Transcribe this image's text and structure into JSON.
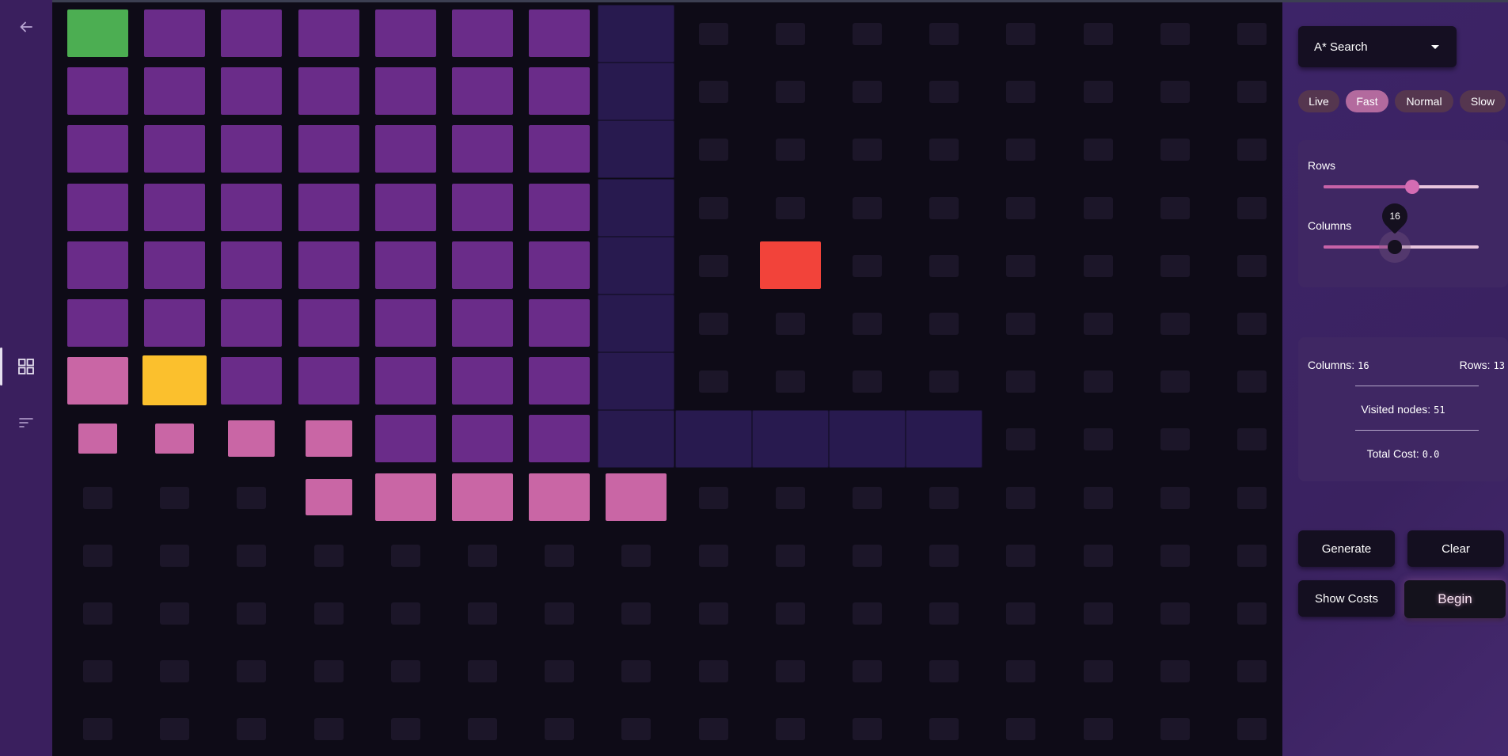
{
  "colors": {
    "empty": "#1c1629",
    "visited": "#6a2c89",
    "frontier": "#281a4f",
    "path": "#c966a5",
    "start": "#4cae52",
    "end": "#f2433a",
    "current": "#fbc02d",
    "panel": "#3d2468",
    "rail": "#3a1f5e"
  },
  "rail": {
    "icons": [
      "back-arrow-icon",
      "grid-icon",
      "sort-icon"
    ]
  },
  "algorithm": {
    "selected": "A* Search"
  },
  "speeds": {
    "options": [
      "Live",
      "Fast",
      "Normal",
      "Slow"
    ],
    "selected": "Fast"
  },
  "sliders": {
    "rows_label": "Rows",
    "rows_fraction": 0.57,
    "columns_label": "Columns",
    "columns_fraction": 0.46,
    "columns_value_label": "16"
  },
  "stats": {
    "columns_label": "Columns:",
    "columns_value": "16",
    "rows_label": "Rows:",
    "rows_value": "13",
    "visited_label": "Visited nodes:",
    "visited_value": "51",
    "cost_label": "Total Cost:",
    "cost_value": "0.0"
  },
  "actions": {
    "generate": "Generate",
    "clear": "Clear",
    "show_costs": "Show Costs",
    "begin": "Begin"
  },
  "grid": {
    "columns": 16,
    "rows": 13,
    "cells": [
      "SVVVVVVFeeeeeeee",
      "VVVVVVVFeeeeeeee",
      "VVVVVVVFeeeeeeee",
      "VVVVVVVFeeeeeeee",
      "VVVVVVVFeXeeeeee",
      "VVVVVVVFeeeeeeee",
      "PCVVVVVFeeeeeeee",
      "ssmmVVVFFFFFeeee",
      "eeemPPPPeeeeeeee",
      "eeeeeeeeeeeeeeee",
      "eeeeeeeeeeeeeeee",
      "eeeeeeeeeeeeeeee",
      "eeeeeeeeeeeeeeee"
    ]
  }
}
